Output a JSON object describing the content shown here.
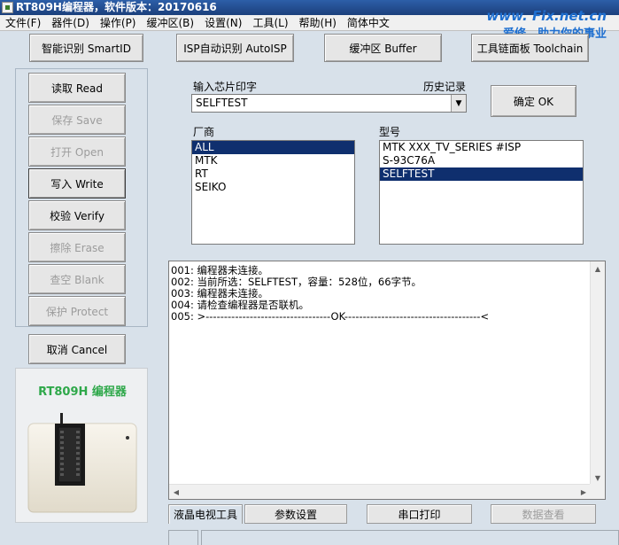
{
  "window": {
    "title": "RT809H编程器，软件版本：20170616"
  },
  "watermark": {
    "line1": "www. Fix.net.cn",
    "line2": "爱修，助力你的事业"
  },
  "menu": [
    "文件(F)",
    "器件(D)",
    "操作(P)",
    "缓冲区(B)",
    "设置(N)",
    "工具(L)",
    "帮助(H)",
    "简体中文"
  ],
  "toolbar": {
    "smartid": "智能识别 SmartID",
    "autoisp": "ISP自动识别 AutoISP",
    "buffer": "缓冲区 Buffer",
    "toolchain": "工具链面板 Toolchain"
  },
  "operations": {
    "read": "读取 Read",
    "save": "保存 Save",
    "open": "打开 Open",
    "write": "写入 Write",
    "verify": "校验 Verify",
    "erase": "擦除 Erase",
    "blank": "查空 Blank",
    "protect": "保护 Protect",
    "cancel": "取消 Cancel"
  },
  "chip": {
    "label": "输入芯片印字",
    "history_label": "历史记录",
    "value": "SELFTEST",
    "ok_button": "确定 OK"
  },
  "vendor": {
    "label": "厂商",
    "items": [
      "ALL",
      "MTK",
      "RT",
      "SEIKO"
    ],
    "selected": "ALL"
  },
  "model": {
    "label": "型号",
    "items": [
      "MTK XXX_TV_SERIES #ISP",
      "S-93C76A",
      "SELFTEST"
    ],
    "selected": "SELFTEST"
  },
  "log": [
    "001: 编程器未连接。",
    "002: 当前所选：SELFTEST，容量：528位，66字节。",
    "003: 编程器未连接。",
    "004: 请检查编程器是否联机。",
    "005: >----------------------------------OK-------------------------------------<"
  ],
  "tabs": {
    "lcd_tool": "液晶电视工具",
    "params": "参数设置",
    "serial_print": "串口打印",
    "data_view": "数据查看"
  },
  "device": {
    "title": "RT809H 编程器"
  }
}
